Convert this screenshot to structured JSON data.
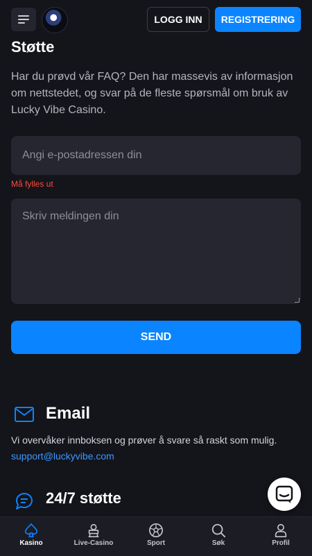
{
  "header": {
    "login_label": "LOGG INN",
    "register_label": "REGISTRERING",
    "logo_alt": "Lucky Vibe Casino logo"
  },
  "support": {
    "title": "Støtte",
    "intro": "Har du prøvd vår FAQ? Den har massevis av informasjon om nettstedet, og svar på de fleste spørsmål om bruk av Lucky Vibe Casino.",
    "email_placeholder": "Angi e-postadressen din",
    "email_value": "",
    "email_error": "Må fylles ut",
    "message_placeholder": "Skriv meldingen din",
    "message_value": "",
    "send_label": "SEND"
  },
  "contact": {
    "email_title": "Email",
    "email_text": "Vi overvåker innboksen og prøver å svare så raskt som mulig.",
    "email_address": "support@luckyvibe.com",
    "support_title": "24/7 støtte"
  },
  "nav": {
    "items": [
      {
        "label": "Kasino",
        "icon": "spade-icon",
        "active": true
      },
      {
        "label": "Live-Casino",
        "icon": "dealer-icon",
        "active": false
      },
      {
        "label": "Sport",
        "icon": "soccer-ball-icon",
        "active": false
      },
      {
        "label": "Søk",
        "icon": "search-icon",
        "active": false
      },
      {
        "label": "Profil",
        "icon": "user-icon",
        "active": false
      }
    ]
  },
  "colors": {
    "background": "#14141b",
    "accent": "#0a84ff",
    "field_bg": "#262630",
    "error": "#ff4b3a",
    "link": "#3b99ff"
  }
}
